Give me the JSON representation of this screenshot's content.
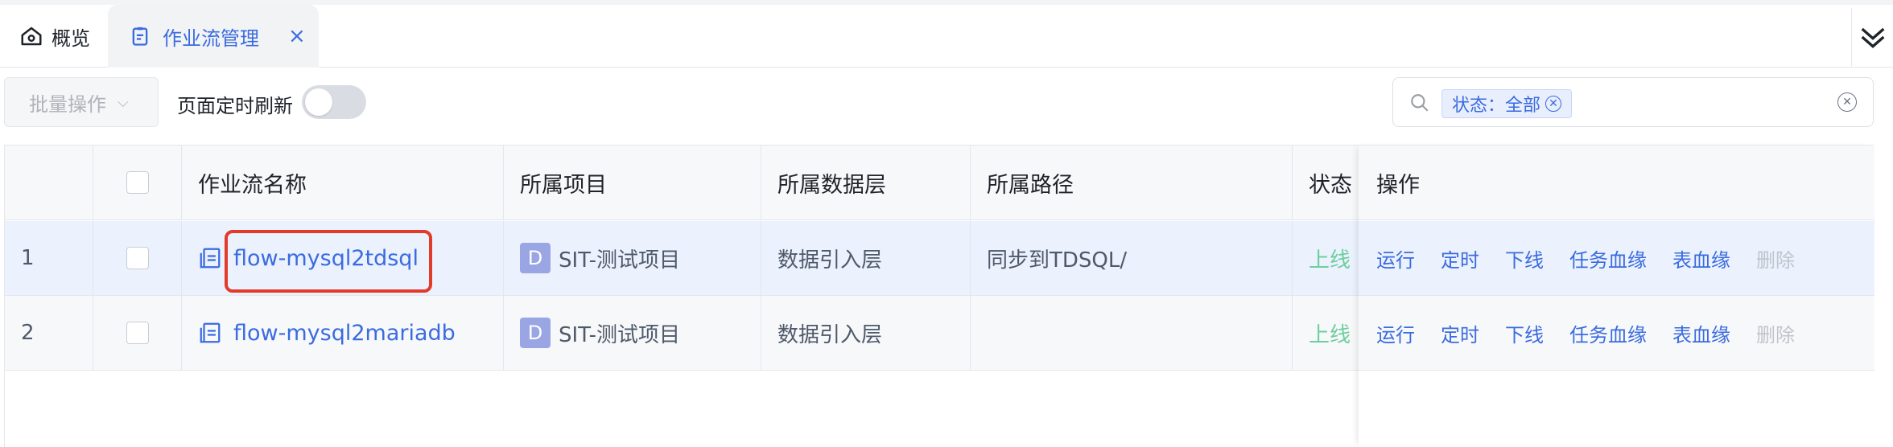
{
  "tabs": {
    "home_label": "概览",
    "active_label": "作业流管理",
    "close_symbol": "×"
  },
  "toolbar": {
    "batch_label": "批量操作",
    "refresh_label": "页面定时刷新",
    "refresh_on": false,
    "filter_tag": "状态：全部"
  },
  "table": {
    "headers": {
      "name": "作业流名称",
      "project": "所属项目",
      "layer": "所属数据层",
      "path": "所属路径",
      "status": "状态",
      "ops": "操作"
    },
    "rows": [
      {
        "index": "1",
        "name": "flow-mysql2tdsql",
        "project_badge": "D",
        "project": "SIT-测试项目",
        "layer": "数据引入层",
        "path": "同步到TDSQL/",
        "status": "上线"
      },
      {
        "index": "2",
        "name": "flow-mysql2mariadb",
        "project_badge": "D",
        "project": "SIT-测试项目",
        "layer": "数据引入层",
        "path": "",
        "status": "上线"
      }
    ],
    "ops": [
      "运行",
      "定时",
      "下线",
      "任务血缘",
      "表血缘",
      "删除"
    ]
  },
  "colors": {
    "accent": "#3a6be0",
    "status_online": "#6dce9e",
    "highlight": "#e23b2a",
    "selected_row": "#ebf1fd"
  }
}
